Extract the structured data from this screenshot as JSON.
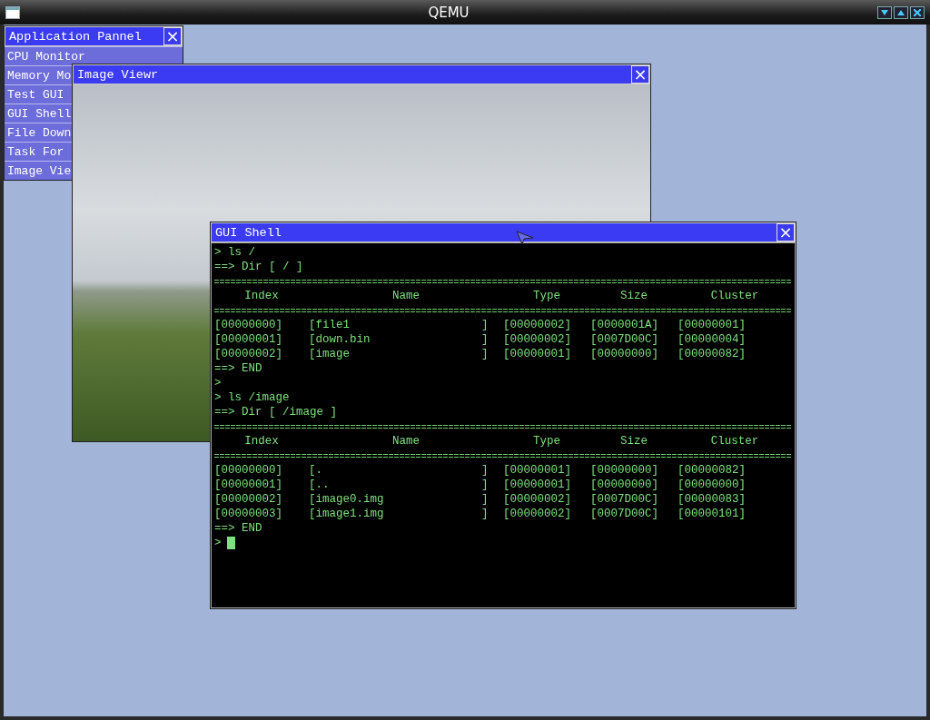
{
  "window": {
    "title": "QEMU"
  },
  "app_panel": {
    "title": "Application Pannel",
    "close": "×",
    "items": [
      "CPU Monitor",
      "Memory Mo",
      "Test GUI",
      "GUI Shell",
      "File Down",
      "Task For",
      "Image Vie"
    ]
  },
  "image_viewer": {
    "title": "Image Viewr",
    "close": "×"
  },
  "shell": {
    "title": "GUI Shell",
    "close": "×",
    "lines": [
      {
        "kind": "text",
        "text": "> ls /"
      },
      {
        "kind": "text",
        "text": "==> Dir [ / ]"
      },
      {
        "kind": "rule"
      },
      {
        "kind": "header",
        "cells": [
          "Index",
          "Name",
          "Type",
          "Size",
          "Cluster"
        ]
      },
      {
        "kind": "rule"
      },
      {
        "kind": "row",
        "cells": [
          "[00000000]",
          "[file1",
          "]",
          "[00000002]",
          "[0000001A]",
          "[00000001]"
        ]
      },
      {
        "kind": "row",
        "cells": [
          "[00000001]",
          "[down.bin",
          "]",
          "[00000002]",
          "[0007D00C]",
          "[00000004]"
        ]
      },
      {
        "kind": "row",
        "cells": [
          "[00000002]",
          "[image",
          "]",
          "[00000001]",
          "[00000000]",
          "[00000082]"
        ]
      },
      {
        "kind": "text",
        "text": "==> END"
      },
      {
        "kind": "text",
        "text": ">"
      },
      {
        "kind": "text",
        "text": "> ls /image"
      },
      {
        "kind": "text",
        "text": "==> Dir [ /image ]"
      },
      {
        "kind": "rule"
      },
      {
        "kind": "header",
        "cells": [
          "Index",
          "Name",
          "Type",
          "Size",
          "Cluster"
        ]
      },
      {
        "kind": "rule"
      },
      {
        "kind": "row",
        "cells": [
          "[00000000]",
          "[.",
          "]",
          "[00000001]",
          "[00000000]",
          "[00000082]"
        ]
      },
      {
        "kind": "row",
        "cells": [
          "[00000001]",
          "[..",
          "]",
          "[00000001]",
          "[00000000]",
          "[00000000]"
        ]
      },
      {
        "kind": "row",
        "cells": [
          "[00000002]",
          "[image0.img",
          "]",
          "[00000002]",
          "[0007D00C]",
          "[00000083]"
        ]
      },
      {
        "kind": "row",
        "cells": [
          "[00000003]",
          "[image1.img",
          "]",
          "[00000002]",
          "[0007D00C]",
          "[00000101]"
        ]
      },
      {
        "kind": "text",
        "text": "==> END"
      },
      {
        "kind": "prompt",
        "text": ">"
      }
    ]
  }
}
